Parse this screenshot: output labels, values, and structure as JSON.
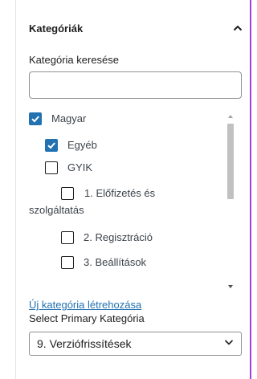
{
  "header": {
    "title": "Kategóriák"
  },
  "search": {
    "label": "Kategória keresése",
    "value": "",
    "placeholder": ""
  },
  "tree": {
    "items": [
      {
        "label": "Magyar",
        "checked": true
      },
      {
        "label": "Egyéb",
        "checked": true
      },
      {
        "label": "GYIK",
        "checked": false
      },
      {
        "label": "1. Előfizetés és",
        "label2": "szolgáltatás",
        "checked": false
      },
      {
        "label": "2. Regisztráció",
        "checked": false
      },
      {
        "label": "3. Beállítások",
        "checked": false
      }
    ]
  },
  "add_link": {
    "label": "Új kategória létrehozása"
  },
  "primary": {
    "label": "Select Primary Kategória",
    "selected": "9. Verziófrissítések"
  },
  "colors": {
    "accent": "#2271b1",
    "focus_border": "#a43fe8"
  }
}
